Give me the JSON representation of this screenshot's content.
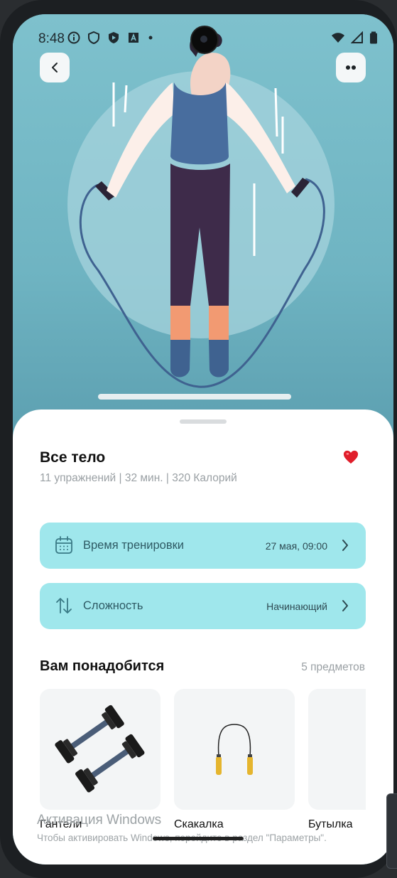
{
  "status_bar": {
    "time": "8:48"
  },
  "header": {
    "back_icon": "chevron-left-icon",
    "more_icon": "dots-icon"
  },
  "workout": {
    "title": "Все тело",
    "meta": "11 упражнений | 32 мин. | 320 Калорий",
    "favorite": true
  },
  "settings": {
    "time_label": "Время тренировки",
    "time_value": "27 мая, 09:00",
    "difficulty_label": "Сложность",
    "difficulty_value": "Начинающий"
  },
  "equipment": {
    "title": "Вам понадобится",
    "count": "5 предметов",
    "items": [
      {
        "label": "Гантели",
        "icon": "dumbbells-icon"
      },
      {
        "label": "Скакалка",
        "icon": "jump-rope-icon"
      },
      {
        "label": "Бутылка",
        "icon": "bottle-icon"
      }
    ]
  },
  "overlay": {
    "watermark_title": "Активация Windows",
    "watermark_sub": "Чтобы активировать Windows, перейдите в раздел \"Параметры\"."
  },
  "colors": {
    "accent_card": "#9fe7ec",
    "hero_bg": "#7ec1cd",
    "heart": "#e01e2b"
  }
}
